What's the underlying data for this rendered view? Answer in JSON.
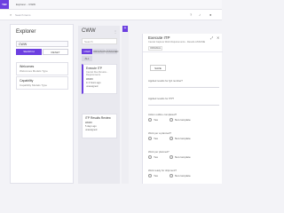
{
  "topbar": {
    "logo": "TBF",
    "breadcrumb": [
      "Explorer",
      "CWW"
    ]
  },
  "search": {
    "placeholder": "Search items"
  },
  "explorer": {
    "title": "Explorer",
    "selected": "CWW",
    "search_label": "SEARCH",
    "reset_label": "RESET",
    "items": [
      {
        "title": "Welcomes",
        "subtitle": "Welcomes Models Type"
      },
      {
        "title": "Capability",
        "subtitle": "Capability Models Type"
      }
    ]
  },
  "cww": {
    "title": "CWW",
    "search_placeholder": "Search",
    "tabs": [
      "CWW",
      "ORIGINATOR",
      "ASSIGNED",
      "ALL"
    ],
    "cards": [
      {
        "title": "Execute ITP",
        "subtitle": "Cancel Due Review - Requirements",
        "id": "#####",
        "meta1": "in 4 hours ago",
        "meta2": "unassigned"
      },
      {
        "title": "ITP Results Review",
        "subtitle": "",
        "id": "#####",
        "meta1": "5 days ago",
        "meta2": "unassigned"
      }
    ]
  },
  "form": {
    "title": "Execute ITP",
    "subtitle": "Cancel Capture Work Requirements - Results ASSUME",
    "tag": "ORIGINAL",
    "save_label": "SAVE",
    "fields": [
      {
        "label": "Applied results for QA number?"
      },
      {
        "label": "Applied results for ITP?"
      }
    ],
    "questions": [
      {
        "label": "Action outline completed?",
        "yes": "Yes",
        "no": "Not complete"
      },
      {
        "label": "Work per a planned?",
        "yes": "Yes",
        "no": "Not complete"
      },
      {
        "label": "Work per planned?",
        "yes": "Yes",
        "no": "Not complete"
      },
      {
        "label": "Work ready for shipment?",
        "yes": "Yes",
        "no": "Not complete"
      }
    ]
  },
  "colors": {
    "accent": "#6c3fe0"
  }
}
